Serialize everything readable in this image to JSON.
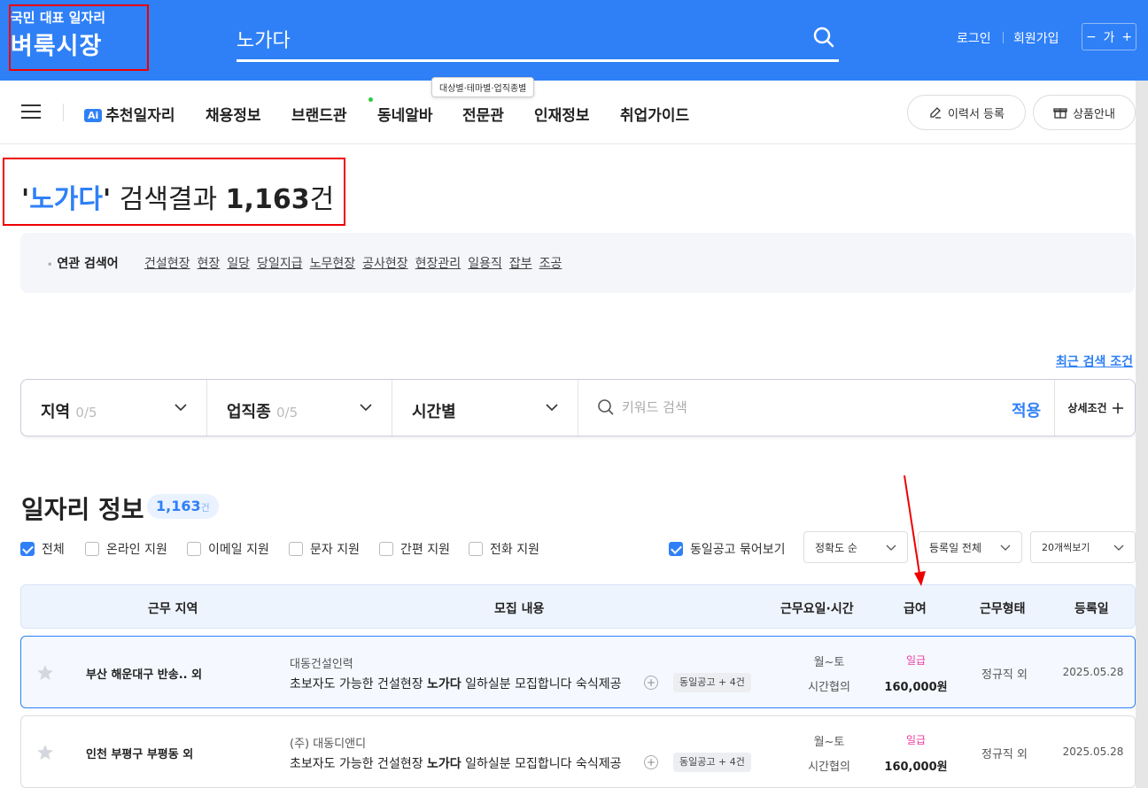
{
  "header": {
    "logo_sub": "국민 대표 일자리",
    "logo_main": "벼룩시장",
    "search_value": "노가다",
    "login": "로그인",
    "signup": "회원가입",
    "font_minus": "−",
    "font_label": "가",
    "font_plus": "+"
  },
  "nav": {
    "ai_badge": "Ai",
    "items": [
      "추천일자리",
      "채용정보",
      "브랜드관",
      "동네알바",
      "전문관",
      "인재정보",
      "취업가이드"
    ],
    "tooltip": "대상별·테마별·업직종별",
    "resume_button": "이력서 등록",
    "product_button": "상품안내"
  },
  "result": {
    "quote_open": "'",
    "keyword": "노가다",
    "quote_close": "'",
    "label": " 검색결과 ",
    "count": "1,163",
    "unit": "건"
  },
  "related": {
    "label": "연관 검색어",
    "terms": [
      "건설현장",
      "현장",
      "일당",
      "당일지급",
      "노무현장",
      "공사현장",
      "현장관리",
      "일용직",
      "잡부",
      "조공"
    ]
  },
  "recent_search": "최근 검색 조건",
  "filter": {
    "region_label": "지역",
    "region_count": "0/5",
    "job_label": "업직종",
    "job_count": "0/5",
    "time_label": "시간별",
    "keyword_placeholder": "키워드 검색",
    "apply": "적용",
    "detail": "상세조건"
  },
  "jobs": {
    "title": "일자리 정보",
    "count": "1,163",
    "count_unit": "건",
    "checkboxes": [
      {
        "label": "전체",
        "checked": true
      },
      {
        "label": "온라인 지원",
        "checked": false
      },
      {
        "label": "이메일 지원",
        "checked": false
      },
      {
        "label": "문자 지원",
        "checked": false
      },
      {
        "label": "간편 지원",
        "checked": false
      },
      {
        "label": "전화 지원",
        "checked": false
      }
    ],
    "group_same": {
      "label": "동일공고 묶어보기",
      "checked": true
    },
    "sort": "정확도 순",
    "period": "등록일 전체",
    "per_page": "20개씩보기"
  },
  "table": {
    "headers": [
      "근무 지역",
      "모집 내용",
      "근무요일·시간",
      "급여",
      "근무형태",
      "등록일"
    ],
    "rows": [
      {
        "region": "부산 해운대구 반송.. 외",
        "company": "대동건설인력",
        "title_pre": "초보자도 가능한 건설현장 ",
        "title_kw": "노가다",
        "title_post": " 일하실분 모집합니다 숙식제공",
        "same": "동일공고 + 4건",
        "days": "월~토",
        "hours": "시간협의",
        "pay_type": "일급",
        "pay": "160,000원",
        "job_type": "정규직 외",
        "date": "2025.05.28"
      },
      {
        "region": "인천 부평구 부평동 외",
        "company": "(주) 대동디앤디",
        "title_pre": "초보자도 가능한 건설현장 ",
        "title_kw": "노가다",
        "title_post": " 일하실분 모집합니다 숙식제공",
        "same": "동일공고 + 4건",
        "days": "월~토",
        "hours": "시간협의",
        "pay_type": "일급",
        "pay": "160,000원",
        "job_type": "정규직 외",
        "date": "2025.05.28"
      }
    ]
  },
  "colors": {
    "brand": "#2f80f7",
    "pay_type": "#ec3ca0",
    "annotation": "#ee0000"
  }
}
